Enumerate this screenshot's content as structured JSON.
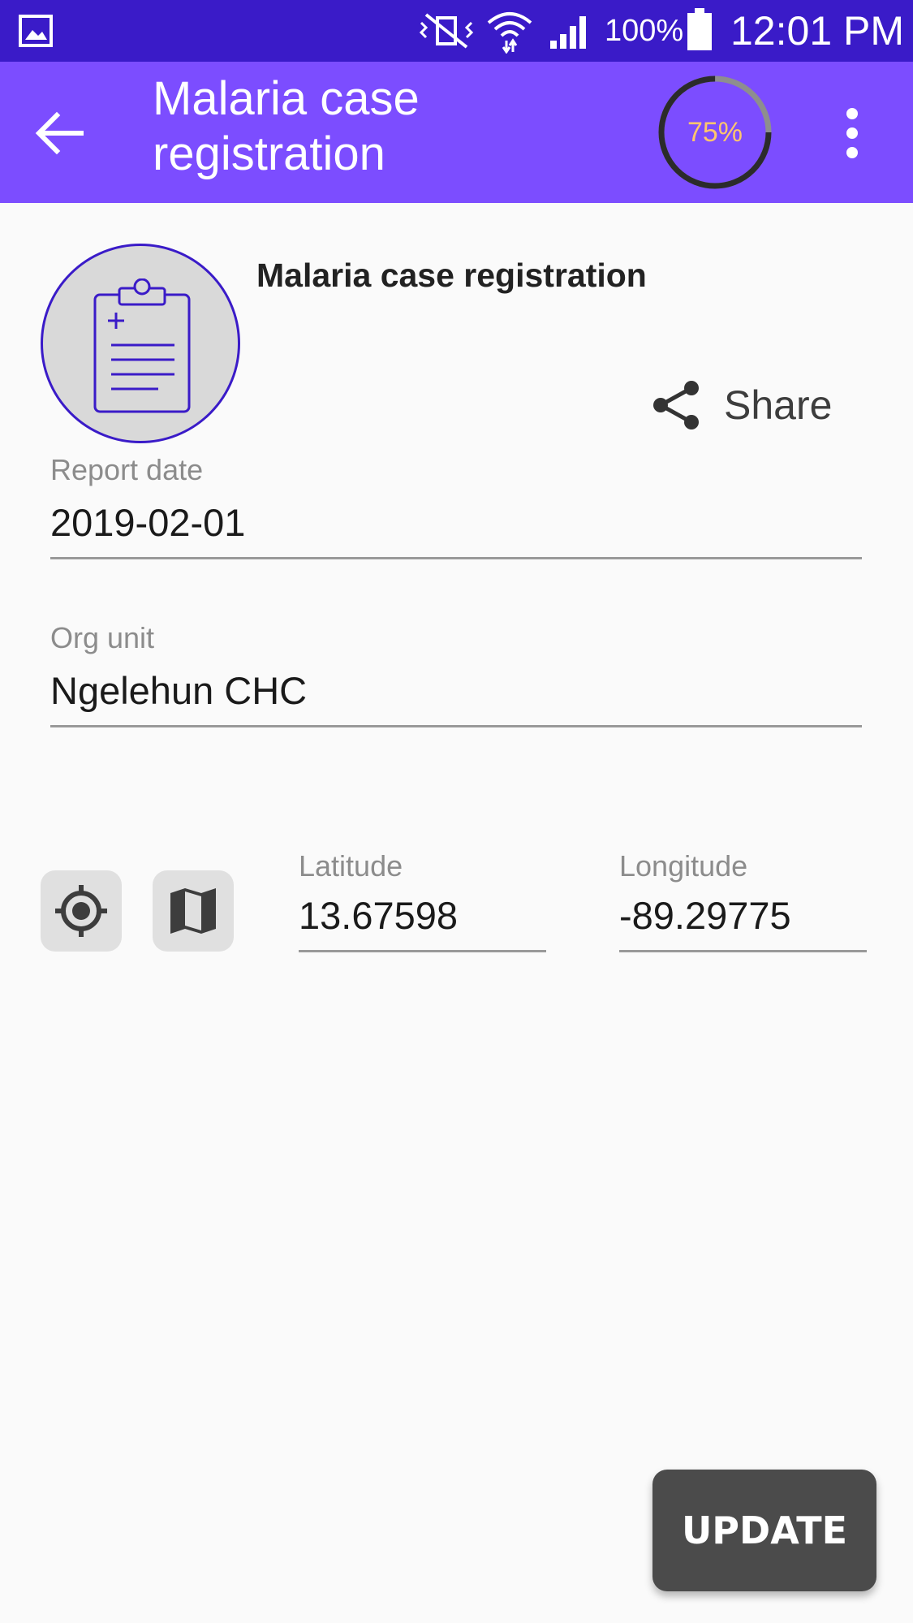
{
  "status_bar": {
    "battery_percent": "100%",
    "time": "12:01 PM",
    "icons": [
      "gallery-icon",
      "vibrate-icon",
      "wifi-icon",
      "signal-icon",
      "battery-icon"
    ]
  },
  "app_bar": {
    "title": "Malaria case registration",
    "progress_label": "75%",
    "progress_value": 0.75,
    "progress_text_color": "#ffc66d",
    "background_color": "#7c4dff"
  },
  "program": {
    "name": "Malaria case registration",
    "share_label": "Share"
  },
  "fields": {
    "report_date": {
      "label": "Report date",
      "value": "2019-02-01"
    },
    "org_unit": {
      "label": "Org unit",
      "value": "Ngelehun CHC"
    }
  },
  "coordinates": {
    "latitude": {
      "label": "Latitude",
      "value": "13.67598"
    },
    "longitude": {
      "label": "Longitude",
      "value": "-89.29775"
    }
  },
  "actions": {
    "update_label": "UPDATE"
  },
  "colors": {
    "status_bar": "#3a1bc8",
    "accent": "#7c4dff",
    "button_dark": "#4b4b4b"
  }
}
